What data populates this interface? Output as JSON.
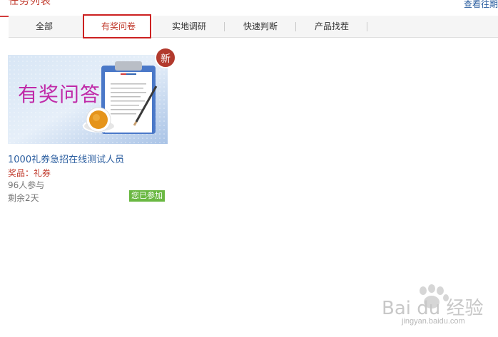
{
  "header": {
    "title": "任务列表",
    "history_link": "查看往期"
  },
  "tabs": [
    {
      "label": "全部",
      "active": false
    },
    {
      "label": "有奖问卷",
      "active": true
    },
    {
      "label": "实地调研",
      "active": false
    },
    {
      "label": "快速判断",
      "active": false
    },
    {
      "label": "产品找茬",
      "active": false
    }
  ],
  "card": {
    "image_title": "有奖问答",
    "new_badge": "新",
    "title": "1000礼券急招在线测试人员",
    "prize_label": "奖品：",
    "prize_value": "礼券",
    "participants": "96人参与",
    "remaining": "剩余2天",
    "status_badge": "您已参加"
  },
  "watermark": {
    "text": "Bai du 经验",
    "url": "jingyan.baidu.com"
  },
  "colors": {
    "accent_red": "#c0392b",
    "link_blue": "#2a5d9f",
    "badge_green": "#6ab842"
  }
}
